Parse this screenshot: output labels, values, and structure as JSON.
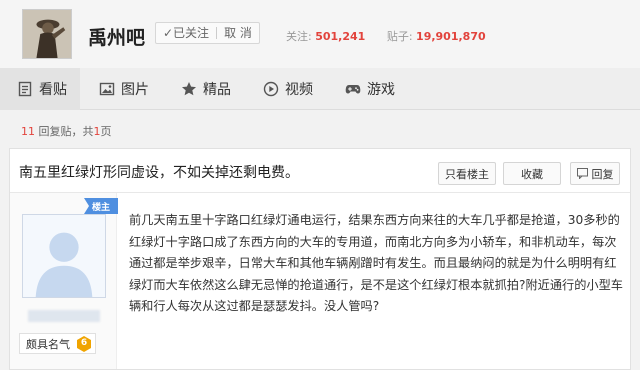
{
  "forum": {
    "name": "禹州吧",
    "follow_label": "✓已关注",
    "cancel_label": "取 消",
    "followers_label": "关注:",
    "followers_count": "501,241",
    "posts_label": "贴子:",
    "posts_count": "19,901,870"
  },
  "tabs": [
    {
      "label": "看贴",
      "icon": "document-icon"
    },
    {
      "label": "图片",
      "icon": "image-icon"
    },
    {
      "label": "精品",
      "icon": "star-icon"
    },
    {
      "label": "视频",
      "icon": "video-icon"
    },
    {
      "label": "游戏",
      "icon": "gamepad-icon"
    }
  ],
  "meta": {
    "reply_count": "11",
    "reply_label": "回复贴，共",
    "page_count": "1",
    "page_label": "页"
  },
  "thread": {
    "title": "南五里红绿灯形同虚设，不如关掉还剩电费。",
    "only_op_label": "只看楼主",
    "favorite_label": "收藏",
    "reply_label": "回复",
    "op_badge": "楼主",
    "rank_label": "颇具名气",
    "rank_level": "6",
    "body": "前几天南五里十字路口红绿灯通电运行，结果东西方向来往的大车几乎都是抢道，30多秒的红绿灯十字路口成了东西方向的大车的专用道，而南北方向多为小轿车，和非机动车，每次通过都是举步艰辛，日常大车和其他车辆剐蹭时有发生。而且最纳闷的就是为什么明明有红绿灯而大车依然这么肆无忌惮的抢道通行，是不是这个红绿灯根本就抓拍?附近通行的小型车辆和行人每次从这过都是瑟瑟发抖。没人管吗?"
  },
  "colors": {
    "accent_red": "#e2433c",
    "level_badge": "#f0a400",
    "op_ribbon": "#4f8fe0"
  }
}
